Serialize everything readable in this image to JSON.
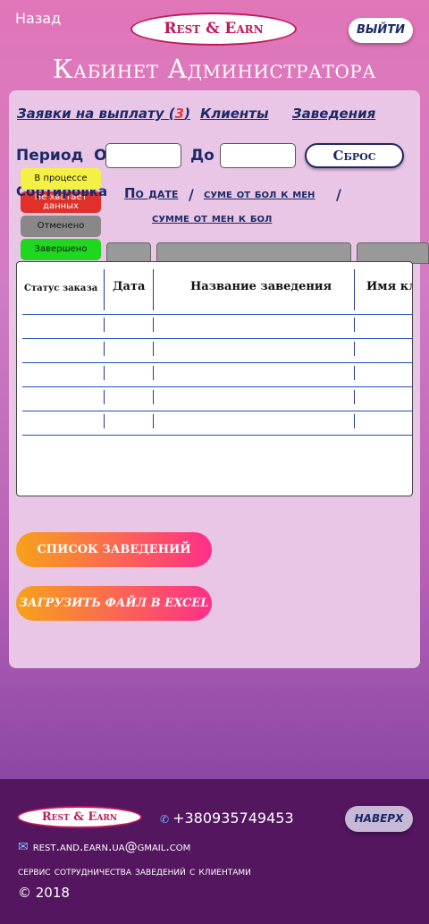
{
  "header": {
    "back": "Назад",
    "logo": "Rest & Earn",
    "logout": "ВЫЙТИ",
    "title": "Кабинет Администратора"
  },
  "nav": {
    "requests_label": "Заявки на выплату",
    "requests_count_open": "(",
    "requests_count": "3",
    "requests_count_close": ")",
    "clients": "Клиенты",
    "establishments": "Заведения"
  },
  "filter": {
    "period": "Период",
    "from": "От",
    "to": "До",
    "from_value": "",
    "to_value": "",
    "reset": "Сброс"
  },
  "sort": {
    "label": "Сортировка",
    "by_date": "По дате",
    "desc": "суме от бол к мен",
    "asc": "сумме от мен к бол",
    "sep": "/"
  },
  "statuses": {
    "in_progress": "В процессе",
    "missing": "Не хватает данных",
    "cancelled": "Отменено",
    "done": "Завершено"
  },
  "table": {
    "columns": [
      "Статус заказа",
      "Дата",
      "Название заведения",
      "Имя клие"
    ],
    "rows": [
      [
        "",
        "",
        "",
        ""
      ],
      [
        "",
        "",
        "",
        ""
      ],
      [
        "",
        "",
        "",
        ""
      ],
      [
        "",
        "",
        "",
        ""
      ],
      [
        "",
        "",
        "",
        ""
      ]
    ]
  },
  "buttons": {
    "list": "Список заведений",
    "excel": "Загрузить файл в Excel"
  },
  "footer": {
    "logo": "Rest & Earn",
    "phone": "+380935749453",
    "top": "НАВЕРХ",
    "email": "rest.and.earn.ua@gmail.com",
    "tagline": "сервис сотрудничества заведений с клиентами",
    "copyright": "© 2018"
  }
}
